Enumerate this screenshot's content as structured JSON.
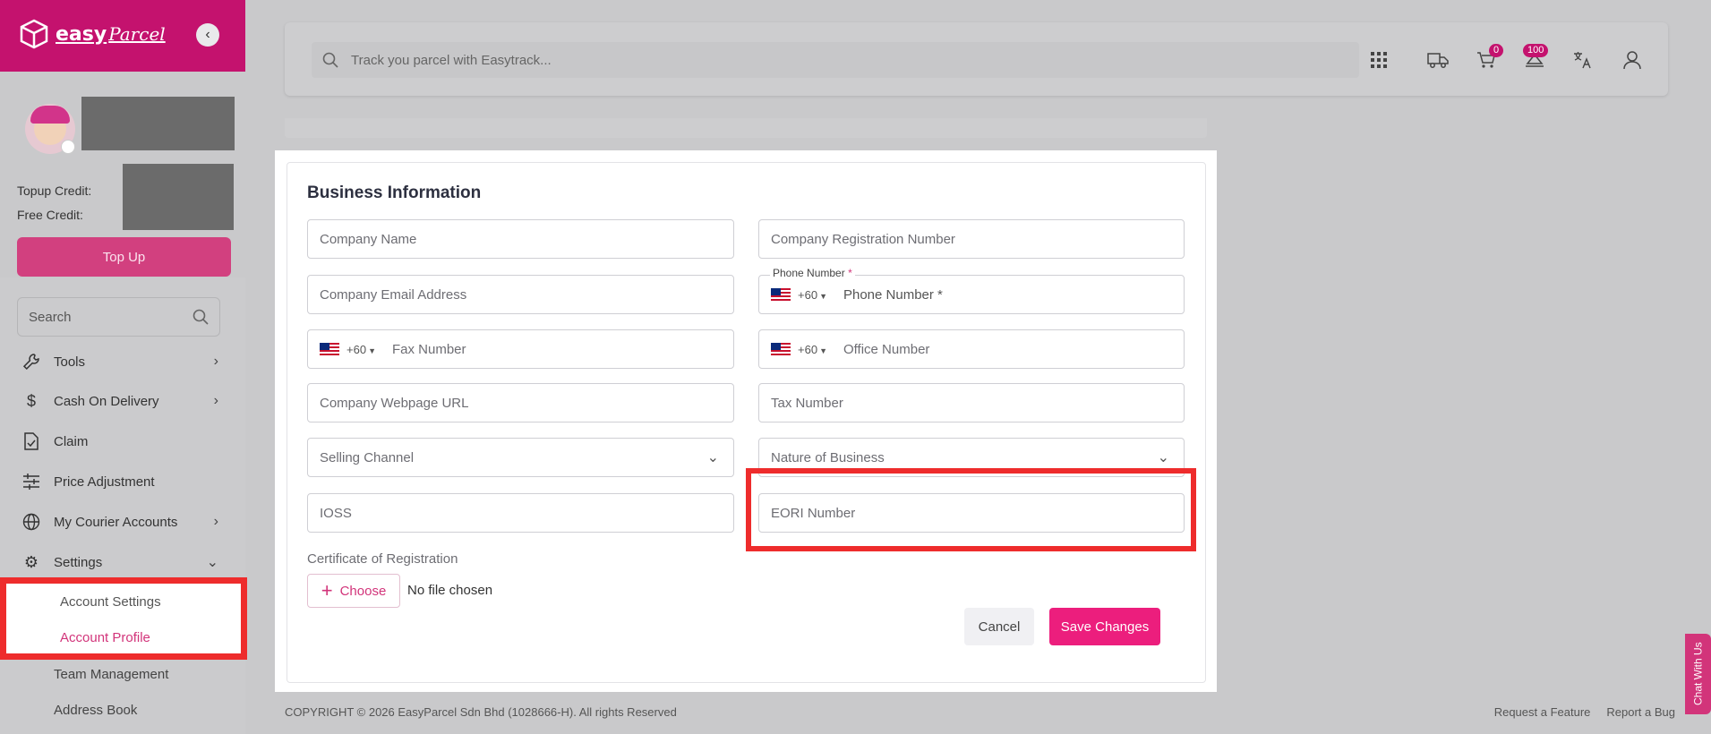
{
  "sidebar": {
    "brand": "easy",
    "brand_script": "Parcel",
    "credit_topup_label": "Topup Credit:",
    "credit_free_label": "Free Credit:",
    "topup_button": "Top Up",
    "search_placeholder": "Search",
    "items": [
      {
        "label": "Tools",
        "icon": "wrench-icon",
        "has_chevron": true
      },
      {
        "label": "Cash On Delivery",
        "icon": "dollar-icon",
        "has_chevron": true
      },
      {
        "label": "Claim",
        "icon": "document-check-icon",
        "has_chevron": false
      },
      {
        "label": "Price Adjustment",
        "icon": "sliders-icon",
        "has_chevron": false
      },
      {
        "label": "My Courier Accounts",
        "icon": "globe-icon",
        "has_chevron": true
      },
      {
        "label": "Settings",
        "icon": "gear-icon",
        "has_chevron": true
      }
    ],
    "settings_sub": {
      "account_settings": "Account Settings",
      "account_profile": "Account Profile",
      "team_management": "Team Management",
      "address_book": "Address Book"
    }
  },
  "topbar": {
    "search_placeholder": "Track you parcel with Easytrack...",
    "cart_badge": "0",
    "notif_badge": "100"
  },
  "form": {
    "title": "Business Information",
    "company_name": "Company Name",
    "company_reg": "Company Registration Number",
    "company_email": "Company Email Address",
    "phone_label": "Phone Number",
    "phone_req": "*",
    "phone_placeholder": "Phone Number *",
    "country_code": "+60",
    "fax": "Fax Number",
    "office": "Office Number",
    "webpage": "Company Webpage URL",
    "tax": "Tax Number",
    "selling_channel": "Selling Channel",
    "nature_of_business": "Nature of Business",
    "ioss": "IOSS",
    "eori": "EORI Number",
    "cert_label": "Certificate of Registration",
    "choose": "Choose",
    "file_status": "No file chosen",
    "cancel": "Cancel",
    "save": "Save Changes"
  },
  "footer": {
    "copyright": "COPYRIGHT © 2026 EasyParcel Sdn Bhd (1028666-H). All rights Reserved",
    "request_feature": "Request a Feature",
    "report_bug": "Report a Bug",
    "chat": "Chat With Us"
  },
  "colors": {
    "brand": "#c4126e",
    "accent": "#ec1e7d",
    "highlight": "#ee2c2c"
  }
}
